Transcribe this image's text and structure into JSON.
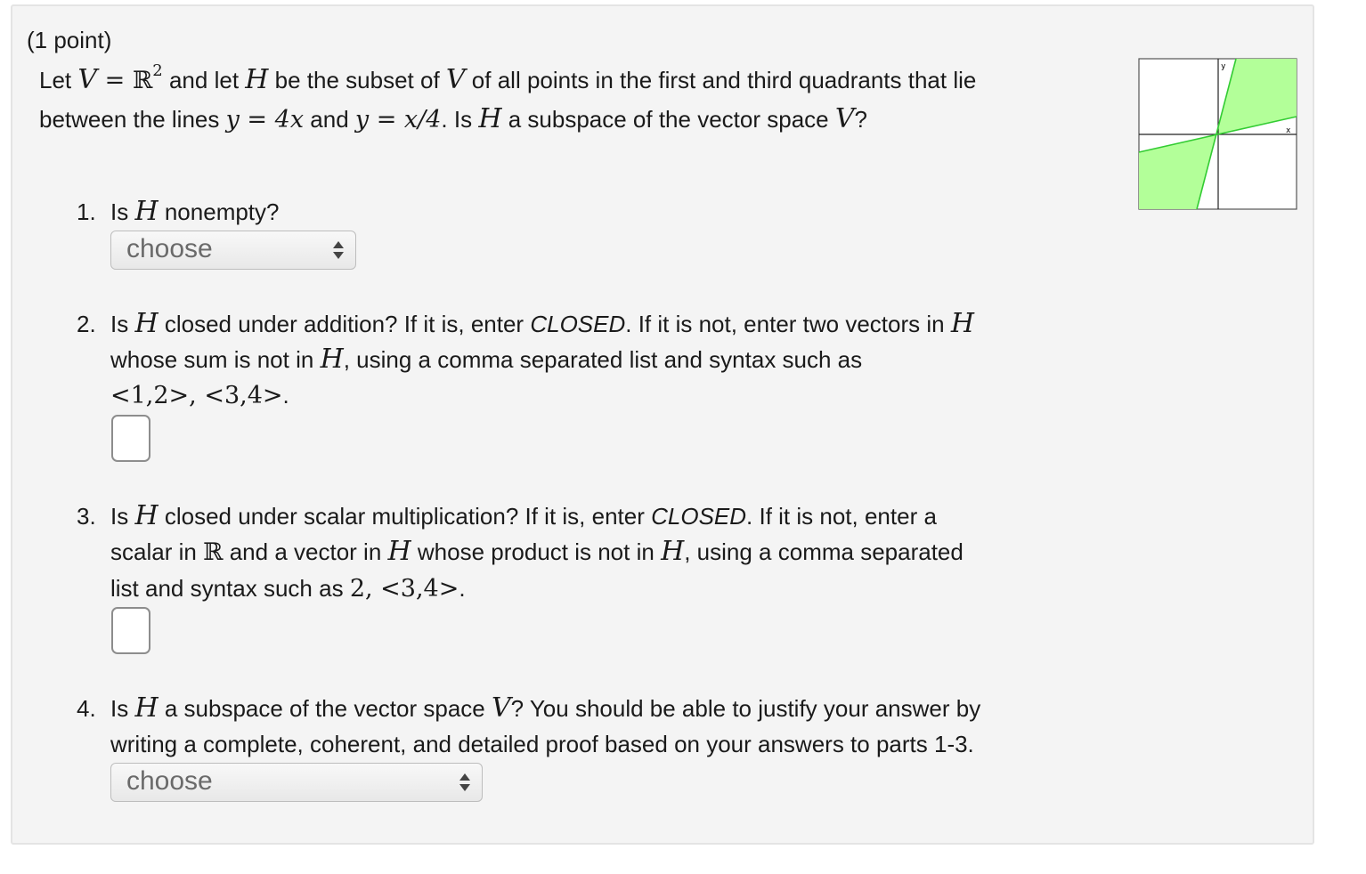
{
  "problem": {
    "points_label": "(1 point)",
    "intro": {
      "t1": "Let ",
      "V": "V",
      "eq": " = ",
      "R": "ℝ",
      "exp": "2",
      "t2": " and let ",
      "H": "H",
      "t3": " be the subset of ",
      "t4": " of all points in the first and third quadrants that lie",
      "t5": "between the lines ",
      "line1": "y = 4x",
      "t6": " and ",
      "line2": "y = x/4",
      "t7": ". Is ",
      "t8": " a subspace of the vector space ",
      "t9": "?"
    },
    "graph": {
      "x_label": "x",
      "y_label": "y",
      "fill_color": "#b3ff99",
      "line_color": "#33cc33"
    }
  },
  "questions": [
    {
      "number": "1.",
      "a": "Is ",
      "H": "H",
      "b": " nonempty?",
      "answer": {
        "type": "select",
        "value": "choose"
      }
    },
    {
      "number": "2.",
      "a": "Is ",
      "H": "H",
      "b": " closed under addition? If it is, enter ",
      "closed": "CLOSED",
      "c": ". If it is not, enter two vectors in ",
      "d": "whose sum is not in ",
      "e": ", using a comma separated list and syntax such as",
      "example": "<1,2>,  <3,4>",
      "f": ".",
      "answer": {
        "type": "text",
        "value": ""
      }
    },
    {
      "number": "3.",
      "a": "Is ",
      "H": "H",
      "b": " closed under scalar multiplication? If it is, enter ",
      "closed": "CLOSED",
      "c": ". If it is not, enter a",
      "d": "scalar in ",
      "R": "ℝ",
      "e": " and a vector in ",
      "f": " whose product is not in ",
      "g": ", using a comma separated",
      "h": "list and syntax such as ",
      "example": "2,  <3,4>",
      "i": ".",
      "answer": {
        "type": "text",
        "value": ""
      }
    },
    {
      "number": "4.",
      "a": "Is ",
      "H": "H",
      "b": " a subspace of the vector space ",
      "V": "V",
      "c": "? You should be able to justify your answer by",
      "d": "writing a complete, coherent, and detailed proof based on your answers to parts 1-3.",
      "answer": {
        "type": "select",
        "value": "choose"
      }
    }
  ]
}
